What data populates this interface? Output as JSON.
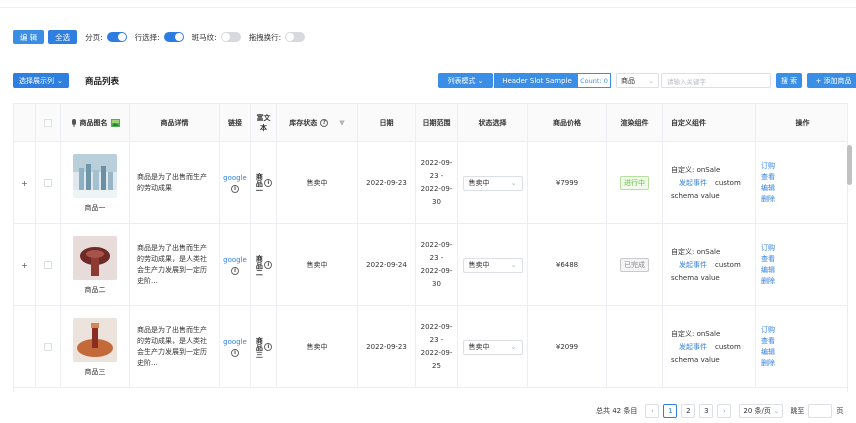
{
  "toolbar": {
    "edit_label": "编 辑",
    "select_all_label": "全选",
    "toggles": [
      {
        "label": "分页:",
        "on": true
      },
      {
        "label": "行选择:",
        "on": true
      },
      {
        "label": "斑马纹:",
        "on": false
      },
      {
        "label": "拖拽换行:",
        "on": false
      }
    ]
  },
  "header_bar": {
    "column_button": "选择展示列",
    "title": "商品列表",
    "mode_button": "列表模式",
    "slot_label": "Header Slot Sample",
    "count_label": "Count: 0",
    "field_select": "商品",
    "search_placeholder": "请输入关键字",
    "search_button": "搜 索",
    "add_button": "+ 添加商品"
  },
  "columns": [
    "商品图名",
    "商品详情",
    "链接",
    "富文本",
    "库存状态",
    "日期",
    "日期范围",
    "状态选择",
    "商品价格",
    "渲染组件",
    "自定义组件",
    "操作"
  ],
  "rows": [
    {
      "image_label": "商品一",
      "detail": "商品是为了出售而生产的劳动成果",
      "link": "google",
      "rich": "商品一",
      "stock": "售卖中",
      "date": "2022-09-23",
      "range_start": "2022-09-23 -",
      "range_end": "2022-09-30",
      "state": "售卖中",
      "price": "¥7999",
      "render_tag": "进行中",
      "render_style": "green",
      "custom_prefix": "自定义: onSale",
      "custom_event": "发起事件",
      "custom_word": "custom",
      "custom_schema": "schema value",
      "ops": [
        "订购",
        "查看",
        "编辑",
        "删除"
      ],
      "expandable": true
    },
    {
      "image_label": "商品二",
      "detail": "商品是为了出售而生产的劳动成果，是人类社会生产力发展到一定历史阶...",
      "link": "google",
      "rich": "商品二",
      "stock": "售卖中",
      "date": "2022-09-24",
      "range_start": "2022-09-23 -",
      "range_end": "2022-09-30",
      "state": "售卖中",
      "price": "¥6488",
      "render_tag": "已完成",
      "render_style": "grey",
      "custom_prefix": "自定义: onSale",
      "custom_event": "发起事件",
      "custom_word": "custom",
      "custom_schema": "schema value",
      "ops": [
        "订购",
        "查看",
        "编辑",
        "删除"
      ],
      "expandable": true
    },
    {
      "image_label": "商品三",
      "detail": "商品是为了出售而生产的劳动成果，是人类社会生产力发展到一定历史阶...",
      "link": "google",
      "rich": "商品三",
      "stock": "售卖中",
      "date": "2022-09-23",
      "range_start": "2022-09-23 -",
      "range_end": "2022-09-25",
      "state": "售卖中",
      "price": "¥2099",
      "render_tag": "",
      "render_style": "none",
      "custom_prefix": "自定义: onSale",
      "custom_event": "发起事件",
      "custom_word": "custom",
      "custom_schema": "schema value",
      "ops": [
        "订购",
        "查看",
        "编辑",
        "删除"
      ],
      "expandable": false
    }
  ],
  "pagination": {
    "total": "总共 42 条目",
    "pages": [
      "1",
      "2",
      "3"
    ],
    "current": "1",
    "page_size": "20 条/页",
    "goto_label": "跳至",
    "page_suffix": "页"
  },
  "colors": {
    "primary": "#2f7fe0",
    "success": "#67c23a",
    "border": "#ebeef5"
  },
  "icons": {
    "prev": "chevron-left-icon",
    "next": "chevron-right-icon",
    "expand": "plus-icon"
  }
}
